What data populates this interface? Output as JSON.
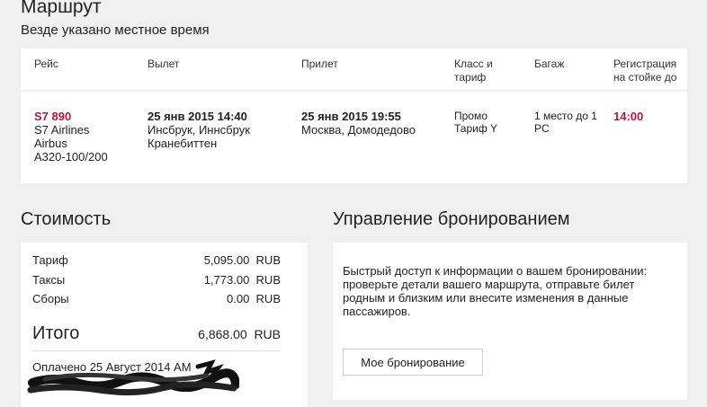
{
  "route": {
    "title": "Маршрут",
    "subtitle": "Везде указано местное время",
    "columns": {
      "flight": "Рейс",
      "departure": "Вылет",
      "arrival": "Прилет",
      "class_line1": "Класс и",
      "class_line2": "тариф",
      "baggage": "Багаж",
      "checkin_line1": "Регистрация",
      "checkin_line2": "на стойке до"
    },
    "segment": {
      "flight_number": "S7 890",
      "airline": "S7 Airlines",
      "aircraft_line1": "Airbus",
      "aircraft_line2": "A320-100/200",
      "dep_datetime": "25 янв 2015 14:40",
      "dep_place_line1": "Инсбрук, Иннсбрук",
      "dep_place_line2": "Кранебиттен",
      "arr_datetime": "25 янв 2015 19:55",
      "arr_place": "Москва, Домодедово",
      "class_line1": "Промо",
      "class_line2": "Тариф Y",
      "baggage_line1": "1 место до 1",
      "baggage_line2": "PC",
      "checkin_time": "14:00"
    }
  },
  "cost": {
    "title": "Стоимость",
    "rows": [
      {
        "label": "Тариф",
        "amount": "5,095.00",
        "currency": "RUB"
      },
      {
        "label": "Таксы",
        "amount": "1,773.00",
        "currency": "RUB"
      },
      {
        "label": "Сборы",
        "amount": "0.00",
        "currency": "RUB"
      }
    ],
    "total_label": "Итого",
    "total_amount": "6,868.00",
    "total_currency": "RUB",
    "paid_text": "Оплачено 25 Август 2014 АМ"
  },
  "management": {
    "title": "Управление бронированием",
    "text_line1": "Быстрый доступ к информации о вашем бронировании:",
    "text_line2": "проверьте детали вашего маршрута, отправьте билет",
    "text_line3": "родным и близким или внесите изменения в данные",
    "text_line4": "пассажиров.",
    "button_label": "Мое бронирование"
  },
  "colors": {
    "accent": "#c0103c",
    "page_bg": "#f0f0f0",
    "card_bg": "#ffffff"
  }
}
